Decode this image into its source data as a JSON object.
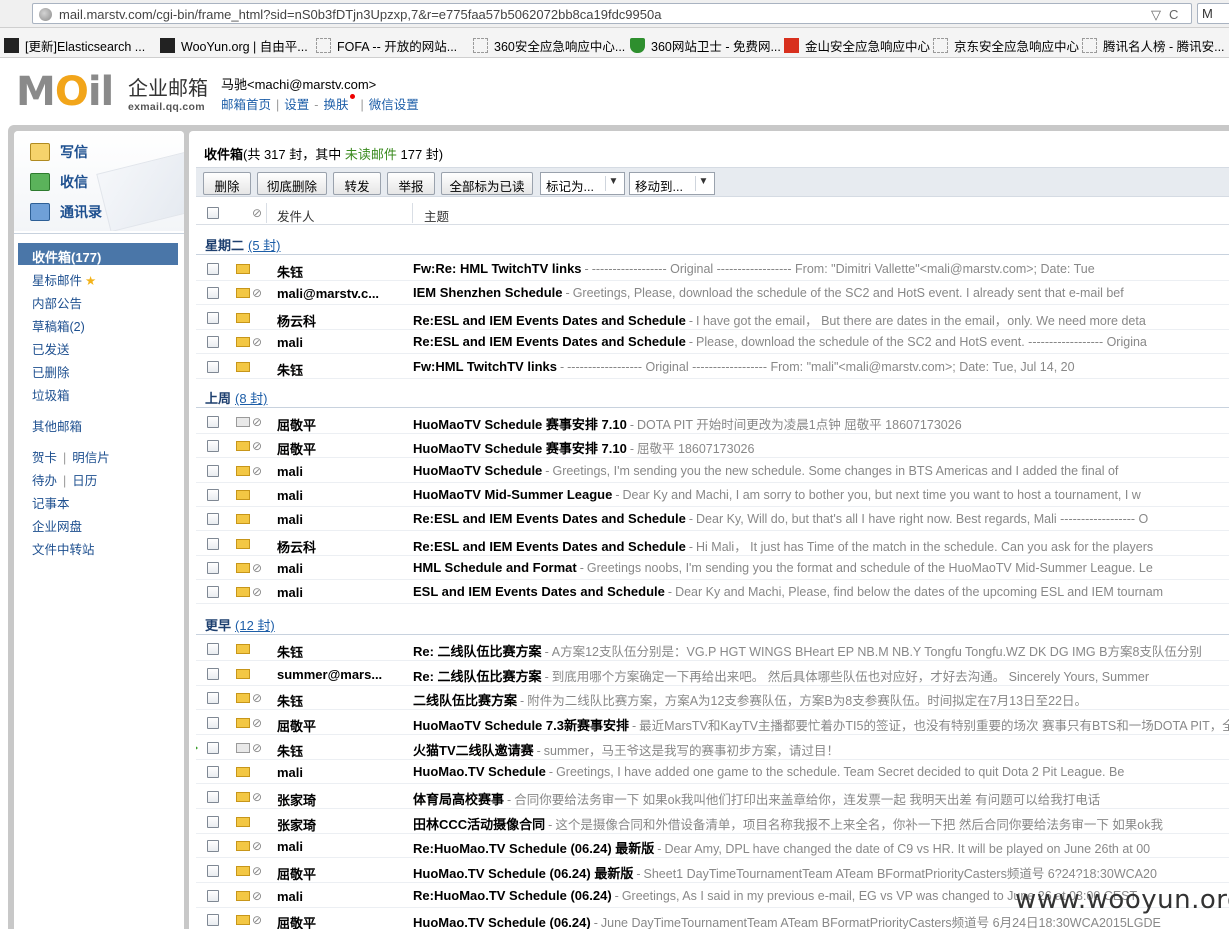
{
  "browser": {
    "url": "mail.marstv.com/cgi-bin/frame_html?sid=nS0b3fDTjn3Upzxp,7&r=e775faa57b5062072bb8ca19fdc9950a",
    "search_glyph": "M",
    "bookmarks": [
      {
        "label": "[更新]Elasticsearch ...",
        "icon": "bookmark-dark-icon"
      },
      {
        "label": "WooYun.org | 自由平...",
        "icon": "bookmark-dark-icon"
      },
      {
        "label": "FOFA -- 开放的网站...",
        "icon": "bookmark-blank-icon"
      },
      {
        "label": "360安全应急响应中心...",
        "icon": "bookmark-blank-icon"
      },
      {
        "label": "360网站卫士 - 免费网...",
        "icon": "shield-icon"
      },
      {
        "label": "金山安全应急响应中心",
        "icon": "bookmark-red-icon"
      },
      {
        "label": "京东安全应急响应中心",
        "icon": "bookmark-blank-icon"
      },
      {
        "label": "腾讯名人榜 - 腾讯安...",
        "icon": "bookmark-blank-icon"
      }
    ]
  },
  "header": {
    "logo_text": "MOil",
    "brand_cn": "企业邮箱",
    "brand_en": "exmail.qq.com",
    "user": "马驰<machi@marstv.com>",
    "links": [
      "邮箱首页",
      "设置",
      "换肤",
      "微信设置"
    ]
  },
  "sidebar": {
    "actions": [
      {
        "label": "写信",
        "icon": "compose-icon"
      },
      {
        "label": "收信",
        "icon": "receive-icon"
      },
      {
        "label": "通讯录",
        "icon": "contacts-icon"
      }
    ],
    "folders": {
      "inbox": "收件箱(177)",
      "starred": "星标邮件",
      "notice": "内部公告",
      "drafts": "草稿箱(2)",
      "sent": "已发送",
      "deleted": "已删除",
      "spam": "垃圾箱",
      "other": "其他邮箱",
      "card": "贺卡",
      "postcard": "明信片",
      "todo": "待办",
      "calendar": "日历",
      "notes": "记事本",
      "disk": "企业网盘",
      "transfer": "文件中转站"
    }
  },
  "main": {
    "folder_name": "收件箱",
    "folder_total": "(共 317 封，其中 ",
    "unread_label": "未读邮件",
    "unread_count": " 177 封)",
    "toolbar": {
      "delete": "删除",
      "delete_forever": "彻底删除",
      "forward": "转发",
      "report": "举报",
      "mark_all_read": "全部标为已读",
      "mark_as": "标记为...",
      "move_to": "移动到..."
    },
    "columns": {
      "sender": "发件人",
      "subject": "主题"
    },
    "groups": [
      {
        "name": "星期二",
        "count": "(5 封)",
        "rows": [
          {
            "sender": "朱钰",
            "subject": "Fw:Re: HML TwitchTV links",
            "preview": "------------------ Original ------------------ From: \"Dimitri Vallette\"<mali@marstv.com>; Date: Tue",
            "attach": false,
            "read": false
          },
          {
            "sender": "mali@marstv.c...",
            "subject": "IEM Shenzhen Schedule",
            "preview": "Greetings, Please, download the schedule of the SC2 and HotS event. I already sent that e-mail bef",
            "attach": true,
            "read": false
          },
          {
            "sender": "杨云科",
            "subject": "Re:ESL and IEM Events Dates and Schedule",
            "preview": "I have got the email， But there are dates in the email，only. We need more deta",
            "attach": false,
            "read": false
          },
          {
            "sender": "mali",
            "subject": "Re:ESL and IEM Events Dates and Schedule",
            "preview": "Please, download the schedule of the SC2 and HotS event. ------------------ Origina",
            "attach": true,
            "read": false
          },
          {
            "sender": "朱钰",
            "subject": "Fw:HML TwitchTV links",
            "preview": "------------------ Original ------------------ From: \"mali\"<mali@marstv.com>; Date: Tue, Jul 14, 20",
            "attach": false,
            "read": false
          }
        ]
      },
      {
        "name": "上周",
        "count": "(8 封)",
        "rows": [
          {
            "sender": "屈敬平",
            "subject": "HuoMaoTV Schedule 赛事安排  7.10",
            "preview": "DOTA PIT 开始时间更改为凌晨1点钟 屈敬平 18607173026",
            "attach": true,
            "read": true
          },
          {
            "sender": "屈敬平",
            "subject": "HuoMaoTV Schedule 赛事安排  7.10",
            "preview": "屈敬平 18607173026",
            "attach": true,
            "read": false
          },
          {
            "sender": "mali",
            "subject": "HuoMaoTV Schedule",
            "preview": "Greetings, I'm sending you the new schedule. Some changes in BTS Americas and I added the final of",
            "attach": true,
            "read": false
          },
          {
            "sender": "mali",
            "subject": "HuoMaoTV Mid-Summer League",
            "preview": "Dear Ky and Machi, I am sorry to bother you, but next time you want to host a tournament, I w",
            "attach": false,
            "read": false
          },
          {
            "sender": "mali",
            "subject": "Re:ESL and IEM Events Dates and Schedule",
            "preview": "Dear Ky, Will do, but that's all I have right now. Best regards, Mali ------------------ O",
            "attach": false,
            "read": false
          },
          {
            "sender": "杨云科",
            "subject": "Re:ESL and IEM Events Dates and Schedule",
            "preview": "Hi Mali， It just has Time of the match in the schedule. Can you ask for the players",
            "attach": false,
            "read": false
          },
          {
            "sender": "mali",
            "subject": "HML Schedule and Format",
            "preview": "Greetings noobs, I'm sending you the format and schedule of the HuoMaoTV Mid-Summer League. Le",
            "attach": true,
            "read": false
          },
          {
            "sender": "mali",
            "subject": "ESL and IEM Events Dates and Schedule",
            "preview": "Dear Ky and Machi, Please, find below the dates of the upcoming ESL and IEM tournam",
            "attach": true,
            "read": false
          }
        ]
      },
      {
        "name": "更早",
        "count": "(12 封)",
        "rows": [
          {
            "sender": "朱钰",
            "subject": "Re: 二线队伍比赛方案",
            "preview": "A方案12支队伍分别是：VG.P HGT WINGS BHeart EP NB.M NB.Y Tongfu Tongfu.WZ DK DG IMG B方案8支队伍分别",
            "attach": false,
            "read": false
          },
          {
            "sender": "summer@mars...",
            "subject": "Re: 二线队伍比赛方案",
            "preview": "到底用哪个方案确定一下再给出来吧。 然后具体哪些队伍也对应好，才好去沟通。 Sincerely Yours, Summer",
            "attach": false,
            "read": false
          },
          {
            "sender": "朱钰",
            "subject": "二线队伍比赛方案",
            "preview": "附件为二线队比赛方案，方案A为12支参赛队伍，方案B为8支参赛队伍。时间拟定在7月13日至22日。",
            "attach": true,
            "read": false
          },
          {
            "sender": "屈敬平",
            "subject": "HuoMaoTV Schedule 7.3新赛事安排",
            "preview": "最近MarsTV和KayTV主播都要忙着办TI5的签证，也没有特别重要的场次 赛事只有BTS和一场DOTA PIT，全",
            "attach": true,
            "read": false
          },
          {
            "sender": "朱钰",
            "subject": "火猫TV二线队邀请赛",
            "preview": "summer，马王爷这是我写的赛事初步方案，请过目！",
            "attach": true,
            "read": true,
            "flag": true
          },
          {
            "sender": "mali",
            "subject": "HuoMao.TV Schedule",
            "preview": "Greetings, I have added one game to the schedule. Team Secret decided to quit Dota 2 Pit League. Be",
            "attach": false,
            "read": false
          },
          {
            "sender": "张家琦",
            "subject": "体育局高校赛事",
            "preview": "合同你要给法务审一下 如果ok我叫他们打印出来盖章给你，连发票一起 我明天出差 有问题可以给我打电话",
            "attach": true,
            "read": false
          },
          {
            "sender": "张家琦",
            "subject": "田林CCC活动摄像合同",
            "preview": "这个是摄像合同和外借设备清单，项目名称我报不上来全名，你补一下把 然后合同你要给法务审一下 如果ok我",
            "attach": false,
            "read": false
          },
          {
            "sender": "mali",
            "subject": "Re:HuoMao.TV Schedule (06.24) 最新版",
            "preview": "Dear Amy, DPL have changed the date of C9 vs HR. It will be played on June 26th at 00",
            "attach": true,
            "read": false
          },
          {
            "sender": "屈敬平",
            "subject": "HuoMao.TV Schedule (06.24) 最新版",
            "preview": "Sheet1 DayTimeTournamentTeam ATeam BFormatPriorityCasters频道号 6?24?18:30WCA20",
            "attach": true,
            "read": false
          },
          {
            "sender": "mali",
            "subject": "Re:HuoMao.TV Schedule (06.24)",
            "preview": "Greetings, As I said in my previous e-mail, EG vs VP was changed to June 26 at 03:00 CEST",
            "attach": true,
            "read": false
          },
          {
            "sender": "屈敬平",
            "subject": "HuoMao.TV Schedule (06.24)",
            "preview": "June DayTimeTournamentTeam ATeam BFormatPriorityCasters频道号 6月24日18:30WCA2015LGDE",
            "attach": true,
            "read": false
          }
        ]
      }
    ]
  },
  "watermark": "www.wooyun.org"
}
